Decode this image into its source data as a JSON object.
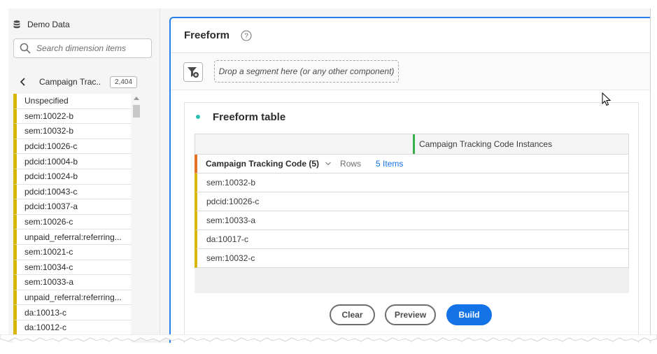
{
  "left_rail": {
    "data_source": "Demo Data",
    "search": {
      "placeholder": "Search dimension items",
      "value": ""
    },
    "dimension": {
      "title": "Campaign Trac...",
      "count": "2,404"
    },
    "items": [
      "Unspecified",
      "sem:10022-b",
      "sem:10032-b",
      "pdcid:10026-c",
      "pdcid:10004-b",
      "pdcid:10024-b",
      "pdcid:10043-c",
      "pdcid:10037-a",
      "sem:10026-c",
      "unpaid_referral:referring...",
      "sem:10021-c",
      "sem:10034-c",
      "sem:10033-a",
      "unpaid_referral:referring...",
      "da:10013-c",
      "da:10012-c"
    ]
  },
  "panel": {
    "title": "Freeform",
    "dropzone_text": "Drop a segment here (or any other component)"
  },
  "viz": {
    "title": "Freeform table",
    "metric_header": "Campaign Tracking Code Instances",
    "dimension_header": "Campaign Tracking Code (5)",
    "rows_label": "Rows",
    "items_link": "5 Items",
    "rows": [
      "sem:10032-b",
      "pdcid:10026-c",
      "sem:10033-a",
      "da:10017-c",
      "sem:10032-c"
    ]
  },
  "buttons": {
    "clear": "Clear",
    "preview": "Preview",
    "build": "Build"
  },
  "colors": {
    "accent": "#1473e6",
    "dimension_marker": "#d7b80a",
    "metric_marker": "#37b04a",
    "dimension_header_marker": "#e47424",
    "viz_dot": "#2dbfb0"
  }
}
